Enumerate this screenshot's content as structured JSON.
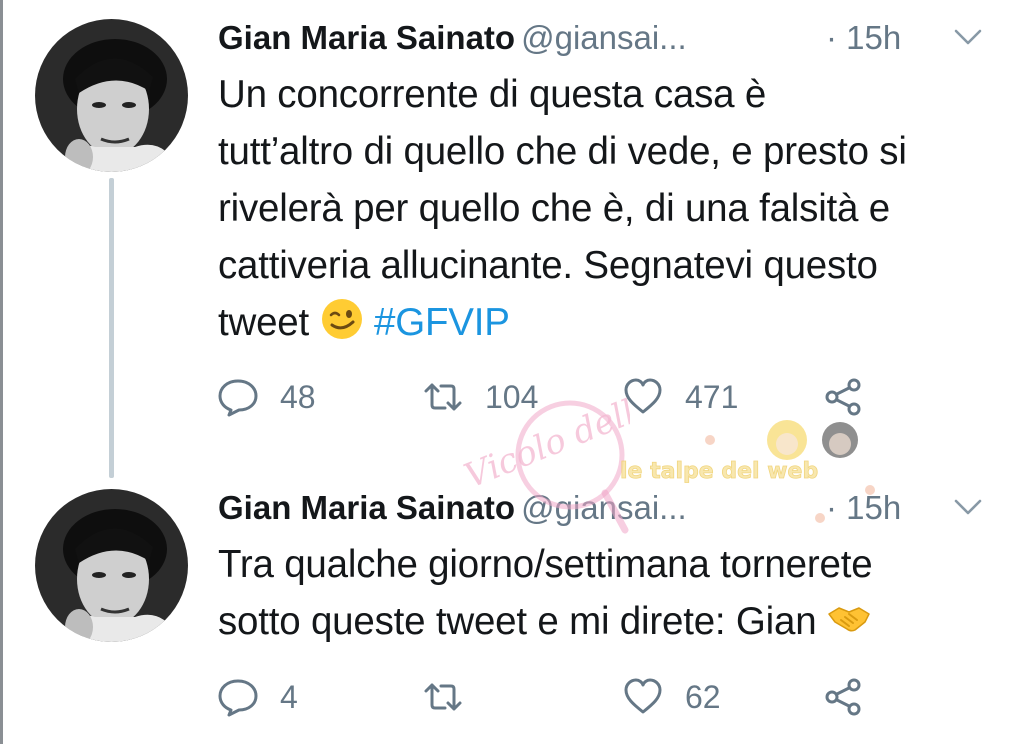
{
  "tweets": [
    {
      "name": "Gian Maria Sainato",
      "handle": "@giansai...",
      "time": "· 15h",
      "text_lines": [
        "Un concorrente di questa casa è",
        "tutt’altro di quello che di vede, e presto si",
        "rivelerà per quello che è, di una falsità e",
        "cattiveria allucinante. Segnatevi questo"
      ],
      "text_last": "tweet",
      "emoji": "winking-face",
      "hashtag": "#GFVIP",
      "replies": "48",
      "retweets": "104",
      "likes": "471"
    },
    {
      "name": "Gian Maria Sainato",
      "handle": "@giansai...",
      "time": "· 15h",
      "text_lines": [
        "Tra qualche giorno/settimana tornerete"
      ],
      "text_last": "sotto queste tweet e mi direte: Gian",
      "emoji": "handshake",
      "replies": "4",
      "retweets": "",
      "likes": "62"
    }
  ],
  "watermarks": {
    "left": "Vicolo delle News",
    "right": "le talpe del web"
  },
  "colors": {
    "text": "#14171a",
    "secondary": "#657786",
    "link": "#1b95e0",
    "thread_line": "#c4cfd6"
  }
}
